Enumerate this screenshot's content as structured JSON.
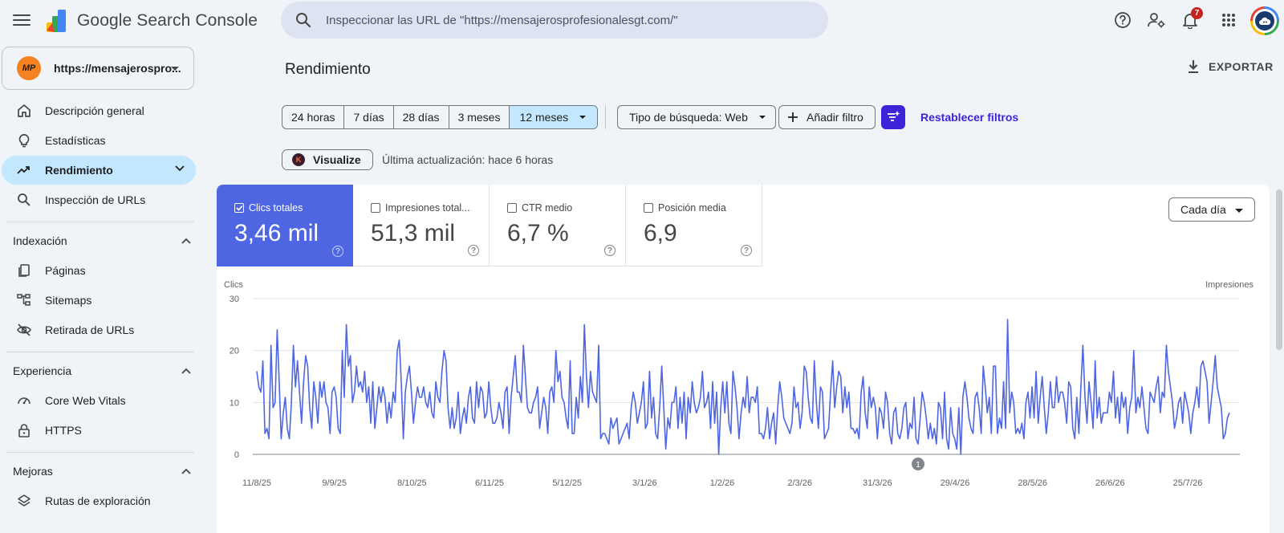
{
  "app": {
    "name": "Google Search Console"
  },
  "search": {
    "placeholder": "Inspeccionar las URL de \"https://mensajerosprofesionalesgt.com/\""
  },
  "header": {
    "notification_count": "7"
  },
  "property": {
    "initials": "MP",
    "label": "https://mensajerospro..."
  },
  "nav": {
    "overview": "Descripción general",
    "stats": "Estadísticas",
    "performance": "Rendimiento",
    "url_inspection": "Inspección de URLs",
    "indexing": {
      "title": "Indexación",
      "items": [
        "Páginas",
        "Sitemaps",
        "Retirada de URLs"
      ]
    },
    "experience": {
      "title": "Experiencia",
      "items": [
        "Core Web Vitals",
        "HTTPS"
      ]
    },
    "enhancements": {
      "title": "Mejoras",
      "items": [
        "Rutas de exploración"
      ]
    }
  },
  "page": {
    "title": "Rendimiento",
    "export_label": "EXPORTAR"
  },
  "toolbar": {
    "ranges": [
      "24 horas",
      "7 días",
      "28 días",
      "3 meses",
      "12 meses"
    ],
    "selected_range": "12 meses",
    "search_type": "Tipo de búsqueda: Web",
    "add_filter": "Añadir filtro",
    "reset_filters": "Restablecer filtros",
    "visualize": "Visualize",
    "visualize_logo": "K",
    "last_update": "Última actualización: hace 6 horas"
  },
  "metrics": [
    {
      "label": "Clics totales",
      "value": "3,46 mil",
      "checked": true
    },
    {
      "label": "Impresiones total...",
      "value": "51,3 mil",
      "checked": false
    },
    {
      "label": "CTR medio",
      "value": "6,7 %",
      "checked": false
    },
    {
      "label": "Posición media",
      "value": "6,9",
      "checked": false
    }
  ],
  "granularity": "Cada día",
  "colors": {
    "accent": "#4f66e2",
    "brand_purple": "#3c24d8",
    "selected_bg": "#c2e7ff"
  },
  "chart_data": {
    "type": "line",
    "ylabel_left": "Clics",
    "ylabel_right": "Impresiones",
    "ylim": [
      0,
      30
    ],
    "yticks": [
      0,
      10,
      20,
      30
    ],
    "xtick_labels": [
      "11/8/25",
      "9/9/25",
      "8/10/25",
      "6/11/25",
      "5/12/25",
      "3/1/26",
      "1/2/26",
      "2/3/26",
      "31/3/26",
      "29/4/26",
      "28/5/26",
      "26/6/26",
      "25/7/26"
    ],
    "annotation": "1",
    "grid": true,
    "series": [
      {
        "name": "Clics totales",
        "values": [
          16,
          13,
          12,
          18,
          4,
          5,
          3,
          21,
          9,
          10,
          24,
          14,
          3,
          8,
          11,
          5,
          3,
          10,
          21,
          13,
          18,
          12,
          6,
          14,
          19,
          17,
          9,
          5,
          14,
          11,
          6,
          14,
          11,
          14,
          10,
          9,
          4,
          12,
          13,
          11,
          5,
          4,
          20,
          11,
          25,
          17,
          19,
          10,
          12,
          17,
          13,
          14,
          12,
          16,
          10,
          13,
          6,
          14,
          5,
          9,
          13,
          10,
          13,
          11,
          6,
          10,
          7,
          12,
          10,
          20,
          22,
          14,
          3,
          12,
          15,
          17,
          12,
          6,
          10,
          13,
          11,
          11,
          13,
          10,
          9,
          12,
          8,
          7,
          14,
          11,
          10,
          16,
          20,
          18,
          9,
          5,
          9,
          5,
          7,
          12,
          4,
          7,
          9,
          6,
          11,
          13,
          7,
          6,
          14,
          9,
          13,
          12,
          7,
          8,
          14,
          9,
          6,
          6,
          7,
          10,
          8,
          5,
          12,
          13,
          4,
          11,
          15,
          19,
          12,
          12,
          10,
          21,
          15,
          9,
          8,
          8,
          10,
          11,
          13,
          5,
          8,
          11,
          9,
          4,
          12,
          13,
          10,
          20,
          14,
          16,
          11,
          10,
          7,
          5,
          18,
          4,
          4,
          11,
          7,
          15,
          10,
          25,
          15,
          9,
          16,
          12,
          11,
          10,
          21,
          3,
          4,
          4,
          3,
          2,
          7,
          5,
          6,
          7,
          2,
          3,
          4,
          5,
          6,
          3,
          9,
          12,
          10,
          6,
          8,
          10,
          14,
          5,
          6,
          16,
          7,
          11,
          4,
          3,
          9,
          17,
          9,
          1,
          7,
          5,
          10,
          10,
          13,
          5,
          11,
          6,
          12,
          3,
          11,
          8,
          14,
          10,
          8,
          9,
          11,
          16,
          9,
          10,
          12,
          5,
          14,
          6,
          12,
          0,
          9,
          14,
          8,
          14,
          6,
          4,
          16,
          13,
          9,
          3,
          8,
          11,
          9,
          15,
          8,
          11,
          11,
          10,
          13,
          4,
          4,
          3,
          5,
          9,
          3,
          6,
          8,
          2,
          9,
          14,
          11,
          7,
          6,
          5,
          4,
          6,
          13,
          9,
          10,
          5,
          8,
          17,
          16,
          11,
          7,
          6,
          18,
          10,
          5,
          13,
          12,
          3,
          4,
          5,
          12,
          18,
          9,
          13,
          16,
          15,
          8,
          13,
          9,
          12,
          5,
          5,
          4,
          5,
          3,
          12,
          15,
          8,
          5,
          13,
          9,
          11,
          9,
          3,
          9,
          8,
          5,
          12,
          10,
          4,
          2,
          8,
          9,
          4,
          3,
          5,
          9,
          10,
          3,
          6,
          5,
          11,
          3,
          2,
          7,
          12,
          10,
          7,
          3,
          6,
          3,
          5,
          2,
          10,
          9,
          3,
          12,
          3,
          1,
          9,
          4,
          3,
          1,
          9,
          0,
          11,
          14,
          11,
          7,
          5,
          4,
          11,
          12,
          9,
          4,
          17,
          13,
          8,
          11,
          4,
          17,
          17,
          4,
          7,
          5,
          14,
          5,
          26,
          8,
          12,
          10,
          4,
          5,
          4,
          6,
          3,
          10,
          12,
          7,
          13,
          7,
          16,
          6,
          11,
          15,
          9,
          4,
          8,
          14,
          9,
          9,
          15,
          10,
          12,
          12,
          10,
          6,
          14,
          13,
          5,
          3,
          11,
          4,
          13,
          21,
          11,
          6,
          14,
          10,
          5,
          18,
          7,
          11,
          6,
          8,
          8,
          8,
          12,
          10,
          16,
          7,
          11,
          6,
          12,
          9,
          11,
          4,
          9,
          11,
          20,
          8,
          11,
          9,
          13,
          9,
          5,
          4,
          12,
          11,
          10,
          13,
          15,
          8,
          12,
          11,
          21,
          16,
          13,
          10,
          5,
          7,
          10,
          11,
          6,
          12,
          10,
          8,
          4,
          8,
          10,
          13,
          9,
          17,
          18,
          16,
          14,
          6,
          10,
          14,
          19,
          13,
          11,
          9,
          3,
          4,
          7,
          8
        ]
      }
    ]
  }
}
